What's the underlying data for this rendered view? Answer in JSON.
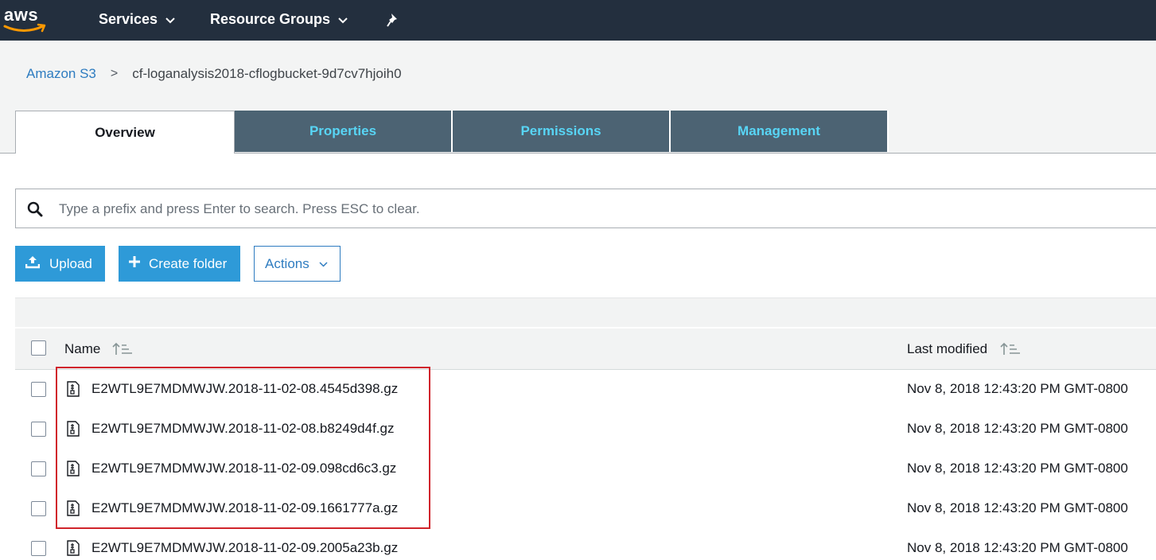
{
  "topnav": {
    "logo_text": "aws",
    "services_label": "Services",
    "resource_groups_label": "Resource Groups",
    "icons": [
      "chevron-down-icon",
      "pin-icon"
    ]
  },
  "breadcrumb": {
    "root": "Amazon S3",
    "separator": ">",
    "current": "cf-loganalysis2018-cflogbucket-9d7cv7hjoih0"
  },
  "tabs": [
    {
      "label": "Overview",
      "active": true
    },
    {
      "label": "Properties",
      "active": false
    },
    {
      "label": "Permissions",
      "active": false
    },
    {
      "label": "Management",
      "active": false
    }
  ],
  "search": {
    "placeholder": "Type a prefix and press Enter to search. Press ESC to clear.",
    "value": ""
  },
  "toolbar": {
    "upload_label": "Upload",
    "create_folder_label": "Create folder",
    "actions_label": "Actions"
  },
  "table": {
    "columns": [
      "Name",
      "Last modified"
    ],
    "rows": [
      {
        "name": "E2WTL9E7MDMWJW.2018-11-02-08.4545d398.gz",
        "modified": "Nov 8, 2018 12:43:20 PM GMT-0800"
      },
      {
        "name": "E2WTL9E7MDMWJW.2018-11-02-08.b8249d4f.gz",
        "modified": "Nov 8, 2018 12:43:20 PM GMT-0800"
      },
      {
        "name": "E2WTL9E7MDMWJW.2018-11-02-09.098cd6c3.gz",
        "modified": "Nov 8, 2018 12:43:20 PM GMT-0800"
      },
      {
        "name": "E2WTL9E7MDMWJW.2018-11-02-09.1661777a.gz",
        "modified": "Nov 8, 2018 12:43:20 PM GMT-0800"
      },
      {
        "name": "E2WTL9E7MDMWJW.2018-11-02-09.2005a23b.gz",
        "modified": "Nov 8, 2018 12:43:20 PM GMT-0800"
      }
    ]
  },
  "colors": {
    "nav_bg": "#232f3e",
    "tab_bg": "#4c6373",
    "tab_text": "#58d5f5",
    "primary_button": "#2e9ad8",
    "link": "#2e7cc0",
    "highlight_border": "#d0242b"
  }
}
